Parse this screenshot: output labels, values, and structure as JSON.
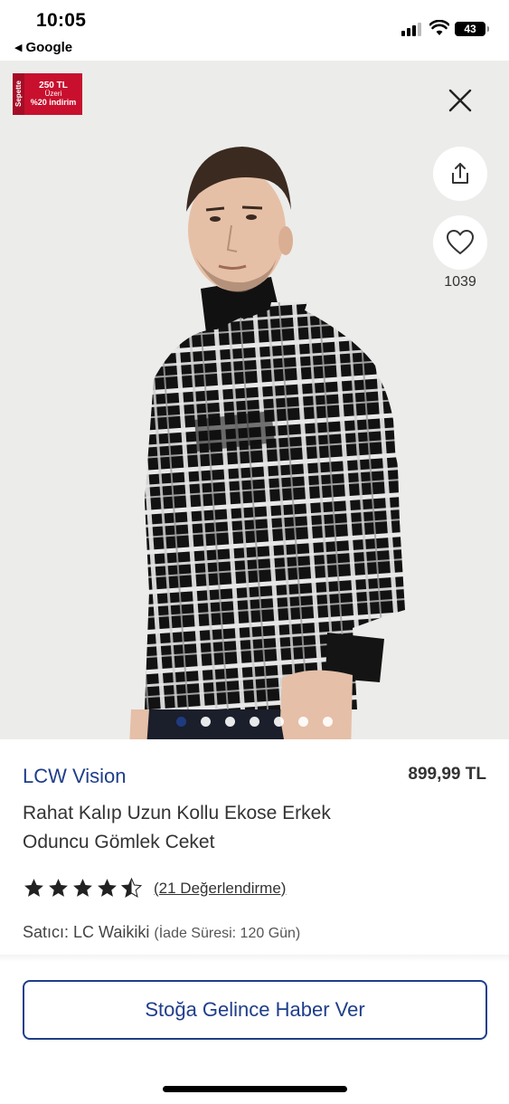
{
  "status_bar": {
    "time": "10:05",
    "back_app": "Google",
    "battery": "43"
  },
  "promo": {
    "side_text": "Sepette",
    "line1": "250 TL",
    "line2": "Üzeri",
    "line3": "%20 indirim"
  },
  "gallery": {
    "favorite_count": "1039",
    "total_images": 7,
    "active_index": 0
  },
  "product": {
    "brand": "LCW Vision",
    "price": "899,99 TL",
    "title": "Rahat Kalıp Uzun Kollu Ekose Erkek Oduncu Gömlek Ceket",
    "rating": 4.5,
    "review_link": "(21 Değerlendirme)",
    "seller_label": "Satıcı: LC Waikiki",
    "return_policy": "(İade Süresi: 120 Gün)"
  },
  "actions": {
    "notify_label": "Stoğa Gelince Haber Ver"
  },
  "icons": {
    "close": "close-icon",
    "share": "share-icon",
    "favorite": "heart-icon",
    "star": "star-icon"
  },
  "colors": {
    "brand_blue": "#1f3e8a",
    "promo_red": "#c8102e"
  }
}
